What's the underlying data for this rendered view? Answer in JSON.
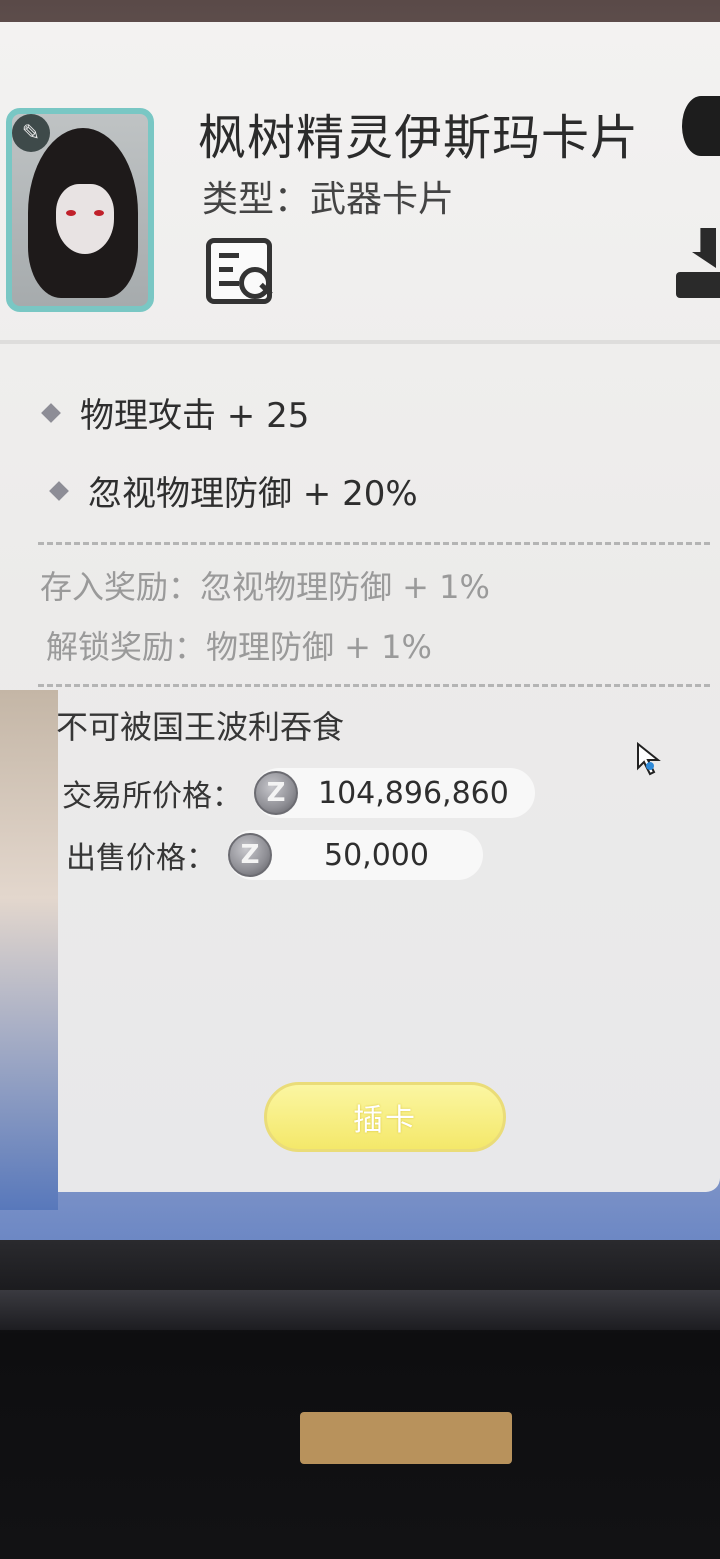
{
  "card": {
    "title": "枫树精灵伊斯玛卡片",
    "type_line": "类型：武器卡片",
    "badge_glyph": "✎"
  },
  "stats": [
    {
      "label": "物理攻击 + 25"
    },
    {
      "label": "忽视物理防御 + 20%"
    }
  ],
  "rewards": {
    "deposit": "存入奖励：忽视物理防御 + 1%",
    "unlock": "解锁奖励：物理防御 + 1%"
  },
  "note": "不可被国王波利吞食",
  "prices": {
    "exchange_label": "交易所价格：",
    "exchange_value": "104,896,860",
    "sell_label": "出售价格：",
    "sell_value": "50,000",
    "currency_glyph": "Z"
  },
  "action": {
    "insert_label": "插卡"
  },
  "colors": {
    "portrait_border": "#79c7c4",
    "button_fill": "#f4e86a"
  }
}
